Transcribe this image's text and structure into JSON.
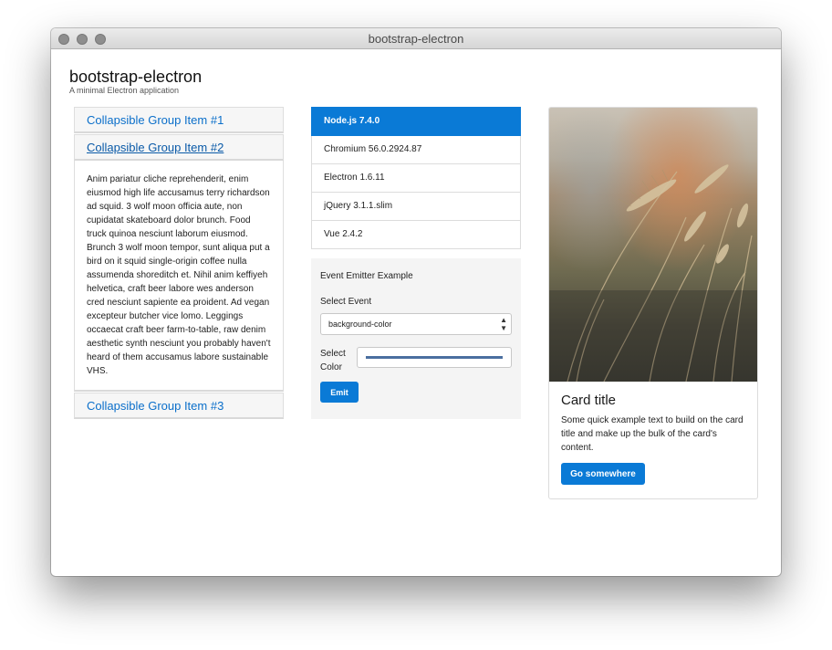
{
  "window": {
    "title": "bootstrap-electron"
  },
  "header": {
    "title": "bootstrap-electron",
    "subtitle": "A minimal Electron application"
  },
  "accordion": {
    "items": [
      {
        "label": "Collapsible Group Item #1"
      },
      {
        "label": "Collapsible Group Item #2",
        "body": "Anim pariatur cliche reprehenderit, enim eiusmod high life accusamus terry richardson ad squid. 3 wolf moon officia aute, non cupidatat skateboard dolor brunch. Food truck quinoa nesciunt laborum eiusmod. Brunch 3 wolf moon tempor, sunt aliqua put a bird on it squid single-origin coffee nulla assumenda shoreditch et. Nihil anim keffiyeh helvetica, craft beer labore wes anderson cred nesciunt sapiente ea proident. Ad vegan excepteur butcher vice lomo. Leggings occaecat craft beer farm-to-table, raw denim aesthetic synth nesciunt you probably haven't heard of them accusamus labore sustainable VHS."
      },
      {
        "label": "Collapsible Group Item #3"
      }
    ]
  },
  "versions": {
    "items": [
      {
        "label": "Node.js 7.4.0"
      },
      {
        "label": "Chromium 56.0.2924.87"
      },
      {
        "label": "Electron 1.6.11"
      },
      {
        "label": "jQuery 3.1.1.slim"
      },
      {
        "label": "Vue 2.4.2"
      }
    ]
  },
  "emitter": {
    "title": "Event Emitter Example",
    "select_label": "Select Event",
    "select_value": "background-color",
    "color_label": "Select Color",
    "color_value": "#4b6fa0",
    "emit_label": "Emit"
  },
  "card": {
    "title": "Card title",
    "text": "Some quick example text to build on the card title and make up the bulk of the card's content.",
    "button_label": "Go somewhere"
  },
  "colors": {
    "accent": "#0a7ad6",
    "link": "#0b6fca"
  }
}
